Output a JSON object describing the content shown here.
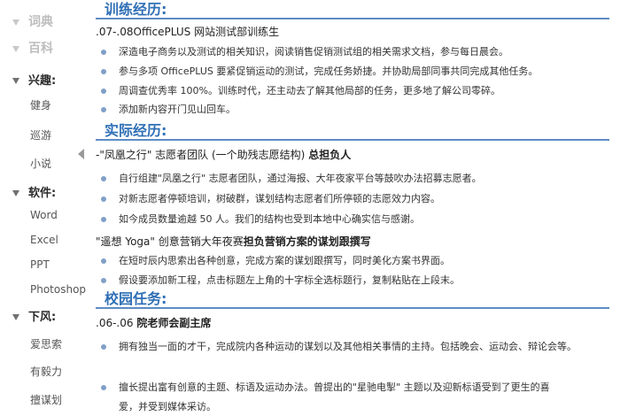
{
  "sidebar": {
    "faint_items": [
      "词典",
      "百科"
    ],
    "groups": [
      {
        "title": "兴趣:",
        "items": [
          "健身",
          "巡游",
          "小说"
        ]
      },
      {
        "title": "软件:",
        "items": [
          "Word",
          "Excel",
          "PPT",
          "Photoshop"
        ]
      },
      {
        "title": "下风:",
        "items": [
          "爱思索",
          "有毅力",
          "擅谋划"
        ]
      }
    ]
  },
  "sections": {
    "training": {
      "title": "训练经历:",
      "subhead": ".07-.08OfficePLUS 网站测试部训练生",
      "bullets": [
        "深造电子商务以及测试的相关知识，阅读销售促销测试组的相关需求文档，参与每日晨会。",
        "参与多项 OfficePLUS 要紧促销运动的测试，完成任务娇捷。并协助局部同事共同完成其他任务。",
        "周调查优秀率 100%。训练时代，还主动去了解其他局部的任务，更多地了解公司零碎。",
        "添加新内容开门见山回车。"
      ]
    },
    "practice": {
      "title": "实际经历:",
      "subhead1_prefix": "-\"凤凰之行\" 志愿者团队 (一个助残志愿结构) ",
      "subhead1_bold": "总担负人",
      "bullets1": [
        "自行组建\"凤凰之行\" 志愿者团队，通过海报、大年夜家平台等鼓吹办法招募志愿者。",
        "对新志愿者停顿培训，树破群，谋划结构志愿者们所停顿的志愿效力内容。",
        "如今成员数量逾越 50 人。我们的结构也受到本地中心确实信与感谢。"
      ],
      "subhead2_prefix": "\"遥想 Yoga\" 创意营销大年夜赛",
      "subhead2_bold": "担负营销方案的谋划跟撰写",
      "bullets2": [
        "在短时辰内思索出各种创意，完成方案的谋划跟撰写，同时美化方案书界面。",
        "假设要添加新工程，点击标题左上角的十字标全选标题行，复制粘贴在上段末。"
      ]
    },
    "campus": {
      "title": "校园任务:",
      "subhead_prefix": ".06-.06 ",
      "subhead_bold": "院老师会副主席",
      "bullets": [
        "拥有独当一面的才干，完成院内各种运动的谋划以及其他相关事情的主持。包括晚会、运动会、辩论会等。",
        "擅长提出富有创意的主题、标语及运动办法。曾提出的\"星驰电掣\" 主题以及迎新标语受到了更生的喜",
        "爱，并受到媒体采访。"
      ]
    }
  }
}
